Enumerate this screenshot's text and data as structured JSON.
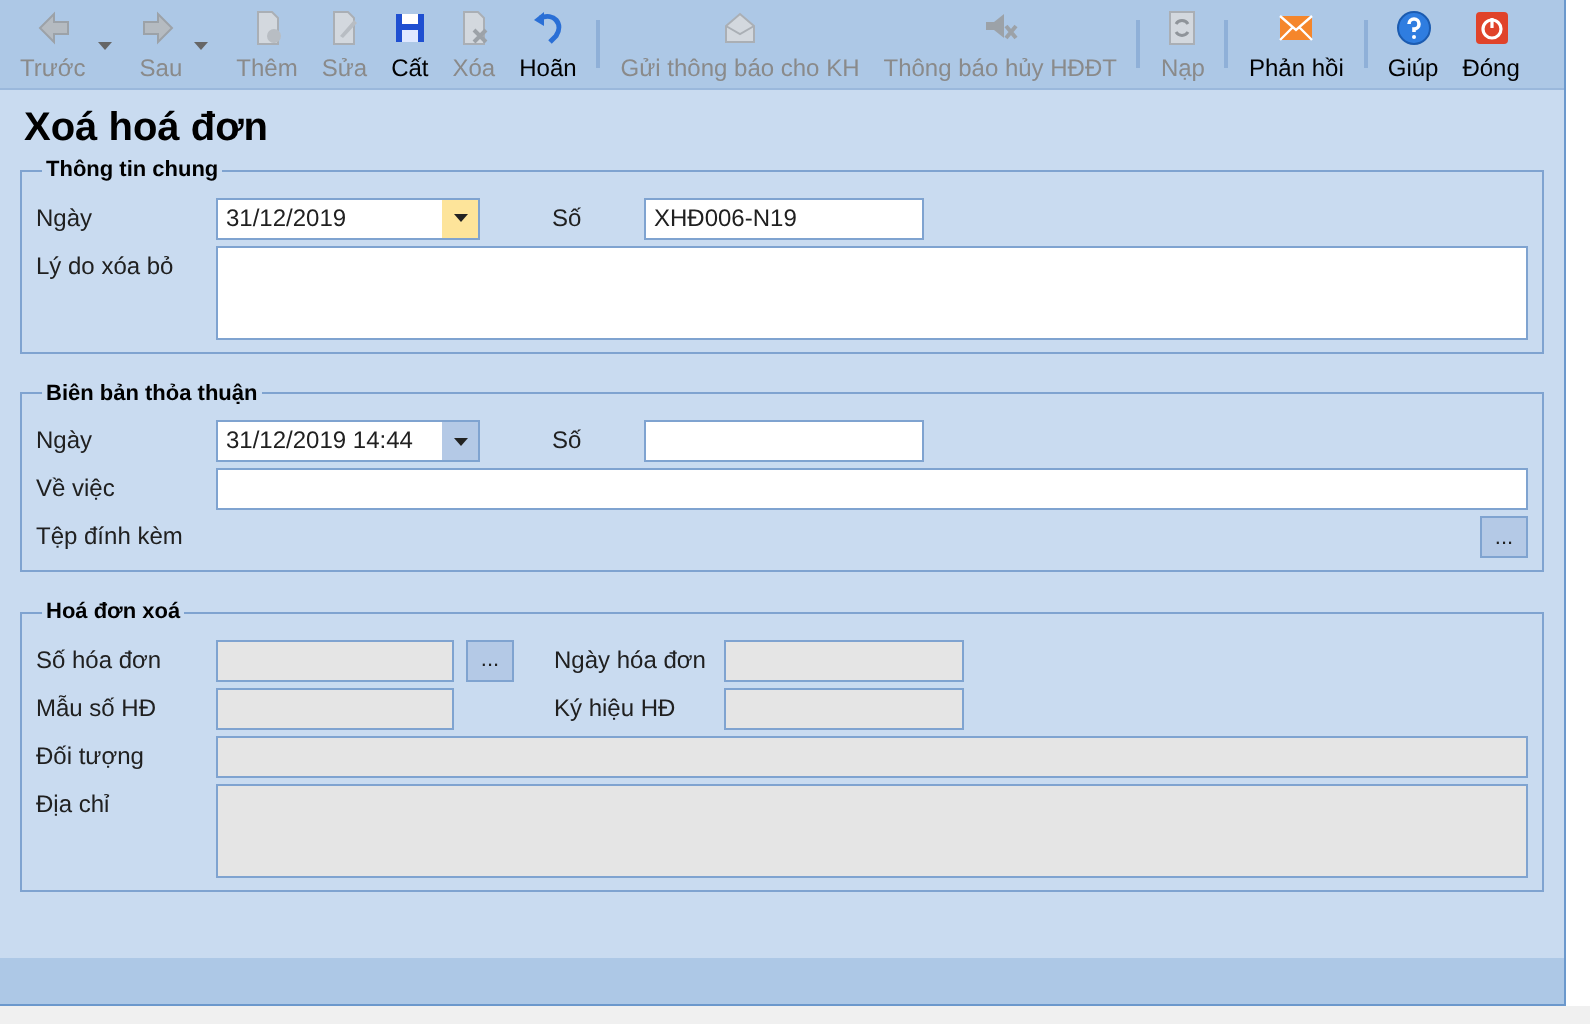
{
  "toolbar": [
    {
      "kind": "back",
      "label": "Trước",
      "disabled": true,
      "dropdown": true,
      "separator_after": false
    },
    {
      "kind": "forward",
      "label": "Sau",
      "disabled": true,
      "dropdown": true,
      "separator_after": false
    },
    {
      "kind": "add",
      "label": "Thêm",
      "disabled": true,
      "dropdown": false,
      "separator_after": false
    },
    {
      "kind": "edit",
      "label": "Sửa",
      "disabled": true,
      "dropdown": false,
      "separator_after": false
    },
    {
      "kind": "save",
      "label": "Cất",
      "disabled": false,
      "dropdown": false,
      "separator_after": false
    },
    {
      "kind": "delete",
      "label": "Xóa",
      "disabled": true,
      "dropdown": false,
      "separator_after": false
    },
    {
      "kind": "undo",
      "label": "Hoãn",
      "disabled": false,
      "dropdown": false,
      "separator_after": true
    },
    {
      "kind": "send",
      "label": "Gửi thông báo cho KH",
      "disabled": true,
      "dropdown": false,
      "separator_after": false
    },
    {
      "kind": "cancel",
      "label": "Thông báo hủy HĐĐT",
      "disabled": true,
      "dropdown": false,
      "separator_after": true
    },
    {
      "kind": "reload",
      "label": "Nạp",
      "disabled": true,
      "dropdown": false,
      "separator_after": true
    },
    {
      "kind": "mail",
      "label": "Phản hồi",
      "disabled": false,
      "dropdown": false,
      "separator_after": true
    },
    {
      "kind": "help",
      "label": "Giúp",
      "disabled": false,
      "dropdown": false,
      "separator_after": false
    },
    {
      "kind": "power",
      "label": "Đóng",
      "disabled": false,
      "dropdown": false,
      "separator_after": false
    }
  ],
  "title": "Xoá hoá đơn",
  "groups": [
    {
      "title": "Thông tin chung",
      "rows": [
        {
          "label": "Ngày",
          "field": {
            "kind": "date",
            "value": "31/12/2019",
            "focused": true,
            "disabled": false
          },
          "label2": "Số",
          "field2": {
            "kind": "text",
            "value": "XHĐ006-N19",
            "disabled": false
          }
        },
        {
          "label": "Lý do xóa bỏ",
          "field": {
            "kind": "textarea",
            "disabled": false
          }
        }
      ]
    },
    {
      "title": "Biên bản thỏa thuận",
      "rows": [
        {
          "label": "Ngày",
          "field": {
            "kind": "date",
            "value": "31/12/2019 14:44",
            "focused": false,
            "disabled": false
          },
          "label2": "Số",
          "field2": {
            "kind": "text",
            "disabled": false
          }
        },
        {
          "label": "Về việc",
          "field": {
            "kind": "text",
            "disabled": false
          }
        },
        {
          "label": "Tệp đính kèm",
          "button": "..."
        }
      ]
    },
    {
      "title": "Hoá đơn xoá",
      "rows": [
        {
          "label": "Số hóa đơn",
          "field": {
            "kind": "text",
            "disabled": true
          },
          "button": "...",
          "label2": "Ngày hóa đơn",
          "field2": {
            "kind": "text",
            "disabled": true
          }
        },
        {
          "label": "Mẫu số HĐ",
          "field": {
            "kind": "text",
            "disabled": true
          },
          "label2": "Ký hiệu HĐ",
          "field2": {
            "kind": "text",
            "disabled": true
          }
        },
        {
          "label": "Đối tượng",
          "field": {
            "kind": "text",
            "disabled": true
          }
        },
        {
          "label": "Địa chỉ",
          "field": {
            "kind": "textarea",
            "disabled": true
          }
        }
      ]
    }
  ]
}
